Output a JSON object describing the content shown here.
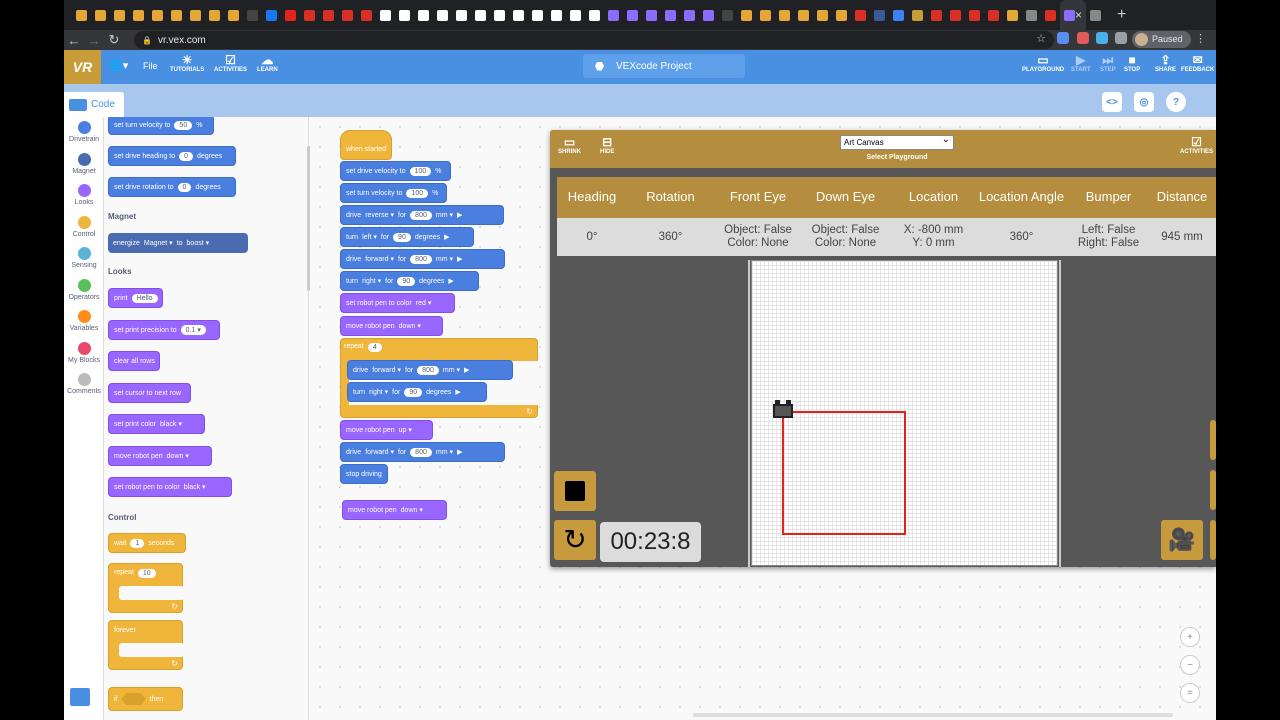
{
  "browser": {
    "url": "vr.vex.com",
    "profile_status": "Paused",
    "tab_close": "×",
    "new_tab": "+",
    "favicon_colors": [
      "#e4a637",
      "#e4a637",
      "#e4a637",
      "#e4a637",
      "#e4a637",
      "#e4a637",
      "#e4a637",
      "#e4a637",
      "#e4a637",
      "#444444",
      "#1877f2",
      "#e2231a",
      "#d93025",
      "#d93025",
      "#d93025",
      "#d93025",
      "#ffffff",
      "#ffffff",
      "#ffffff",
      "#ffffff",
      "#ffffff",
      "#ffffff",
      "#ffffff",
      "#ffffff",
      "#ffffff",
      "#ffffff",
      "#ffffff",
      "#ffffff",
      "#8a6cff",
      "#8a6cff",
      "#8a6cff",
      "#8a6cff",
      "#8a6cff",
      "#8a6cff",
      "#444444",
      "#e4a637",
      "#e4a637",
      "#e4a637",
      "#e4a637",
      "#e4a637",
      "#e4a637",
      "#d93025",
      "#3b5998",
      "#3b82f6",
      "#c99c3a",
      "#d93025",
      "#d93025",
      "#d93025",
      "#d93025",
      "#e4a637",
      "#888888",
      "#d93025",
      "#8a6cff",
      "#888888"
    ]
  },
  "appbar": {
    "logo": "VR",
    "file": "File",
    "tutorials": "TUTORIALS",
    "activities": "ACTIVITIES",
    "learn": "LEARN",
    "project_title": "VEXcode Project",
    "playground": "PLAYGROUND",
    "start": "START",
    "step": "STEP",
    "stop": "STOP",
    "share": "SHARE",
    "feedback": "FEEDBACK"
  },
  "subbar": {
    "code_tab": "Code"
  },
  "categories": [
    {
      "label": "Drivetrain",
      "color": "#4a7fe0"
    },
    {
      "label": "Magnet",
      "color": "#4a6bb0"
    },
    {
      "label": "Looks",
      "color": "#9966ff"
    },
    {
      "label": "Control",
      "color": "#f0b63c"
    },
    {
      "label": "Sensing",
      "color": "#5cb1d6"
    },
    {
      "label": "Operators",
      "color": "#59c059"
    },
    {
      "label": "Variables",
      "color": "#ff8c1a"
    },
    {
      "label": "My Blocks",
      "color": "#e8486b"
    },
    {
      "label": "Comments",
      "color": "#bbbbbb"
    }
  ],
  "palette": {
    "turn_velocity": {
      "text": "set turn velocity to",
      "value": "50",
      "unit": "%"
    },
    "drive_heading": {
      "text": "set drive heading to",
      "value": "0",
      "unit": "degrees"
    },
    "drive_rotation": {
      "text": "set drive rotation to",
      "value": "0",
      "unit": "degrees"
    },
    "magnet_title": "Magnet",
    "energize": {
      "text": "energize",
      "target": "Magnet",
      "to": "to",
      "mode": "boost"
    },
    "looks_title": "Looks",
    "print": {
      "text": "print",
      "value": "Hello"
    },
    "precision": {
      "text": "set print precision to",
      "value": "0.1"
    },
    "clear_rows": "clear all rows",
    "next_row": "set cursor to next row",
    "print_color": {
      "text": "set print color",
      "value": "black"
    },
    "pen": {
      "text": "move robot pen",
      "value": "down"
    },
    "pen_color": {
      "text": "set robot pen to color",
      "value": "black"
    },
    "control_title": "Control",
    "wait": {
      "text": "wait",
      "value": "1",
      "unit": "seconds"
    },
    "repeat": {
      "text": "repeat",
      "value": "10"
    },
    "forever": "forever",
    "if": {
      "text": "if",
      "then": "then"
    }
  },
  "script": {
    "hat": "when started",
    "b1": {
      "text": "set drive velocity to",
      "value": "100",
      "unit": "%"
    },
    "b2": {
      "text": "set turn velocity to",
      "value": "100",
      "unit": "%"
    },
    "b3": {
      "text": "drive",
      "dir": "reverse",
      "for": "for",
      "value": "800",
      "unit": "mm"
    },
    "b4": {
      "text": "turn",
      "dir": "left",
      "for": "for",
      "value": "90",
      "unit": "degrees"
    },
    "b5": {
      "text": "drive",
      "dir": "forward",
      "for": "for",
      "value": "800",
      "unit": "mm"
    },
    "b6": {
      "text": "turn",
      "dir": "right",
      "for": "for",
      "value": "90",
      "unit": "degrees"
    },
    "b7": {
      "text": "set robot pen to color",
      "value": "red"
    },
    "b8": {
      "text": "move robot pen",
      "value": "down"
    },
    "repeat": {
      "text": "repeat",
      "value": "4"
    },
    "r1": {
      "text": "drive",
      "dir": "forward",
      "for": "for",
      "value": "800",
      "unit": "mm"
    },
    "r2": {
      "text": "turn",
      "dir": "right",
      "for": "for",
      "value": "90",
      "unit": "degrees"
    },
    "b9": {
      "text": "move robot pen",
      "value": "up"
    },
    "b10": {
      "text": "drive",
      "dir": "forward",
      "for": "for",
      "value": "800",
      "unit": "mm"
    },
    "b11": "stop driving",
    "loose": {
      "text": "move robot pen",
      "value": "down"
    }
  },
  "playground": {
    "shrink": "SHRINK",
    "hide": "HIDE",
    "activities": "ACTIVITIES",
    "selected": "Art Canvas",
    "select_label": "Select Playground",
    "headers": [
      "Heading",
      "Rotation",
      "Front Eye",
      "Down Eye",
      "Location",
      "Location Angle",
      "Bumper",
      "Distance"
    ],
    "values": [
      "0°",
      "360°",
      "Object: False\nColor: None",
      "Object: False\nColor: None",
      "X: -800 mm\nY: 0 mm",
      "360°",
      "Left: False\nRight: False",
      "945 mm"
    ],
    "timer": "00:23:8",
    "pen_color": "#e2231a"
  },
  "zoom": {
    "in": "+",
    "out": "−",
    "reset": "="
  }
}
